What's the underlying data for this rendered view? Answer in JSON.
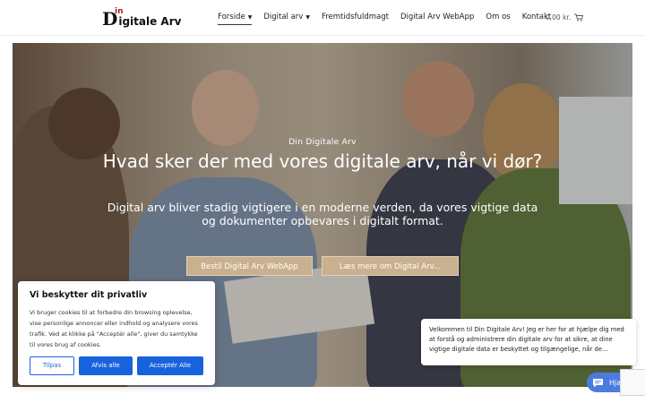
{
  "brand": {
    "logo_letter": "D",
    "logo_superscript": "in",
    "logo_text": "igitale Arv"
  },
  "nav": [
    {
      "label": "Forside",
      "has_dropdown": true,
      "active": true
    },
    {
      "label": "Digital arv",
      "has_dropdown": true,
      "active": false
    },
    {
      "label": "Fremtidsfuldmagt",
      "has_dropdown": false,
      "active": false
    },
    {
      "label": "Digital Arv WebApp",
      "has_dropdown": false,
      "active": false
    },
    {
      "label": "Om os",
      "has_dropdown": false,
      "active": false
    },
    {
      "label": "Kontakt",
      "has_dropdown": false,
      "active": false
    }
  ],
  "cart": {
    "amount": "0,00 kr.",
    "icon": "cart-icon"
  },
  "hero": {
    "eyebrow": "Din Digitale Arv",
    "headline": "Hvad sker der med vores digitale arv, når vi dør?",
    "lead": "Digital arv bliver stadig vigtigere i en moderne verden, da vores vigtige data og dokumenter opbevares i digitalt format.",
    "button_primary": "Bestil Digital Arv WebApp",
    "button_secondary": "Læs mere om Digital Arv..."
  },
  "cookie": {
    "title": "Vi beskytter dit privatliv",
    "body": "Vi bruger cookies til at forbedre din browsing oplevelse, vise personlige annoncer eller indhold og analysere vores trafik. Ved at klikke på \"Acceptér alle\", giver du samtykke til vores brug af cookies.",
    "customize": "Tilpas",
    "reject": "Afvis alle",
    "accept": "Acceptér Alle",
    "accent": "#1863dc"
  },
  "chat": {
    "message": "Velkommen til Din Digitale Arv! Jeg er her for at hjælpe dig med at forstå og administrere din digitale arv for at sikre, at dine vigtige digitale data er beskyttet og tilgængelige, når de...",
    "help_label": "Hjælp",
    "icon": "chat-icon"
  }
}
